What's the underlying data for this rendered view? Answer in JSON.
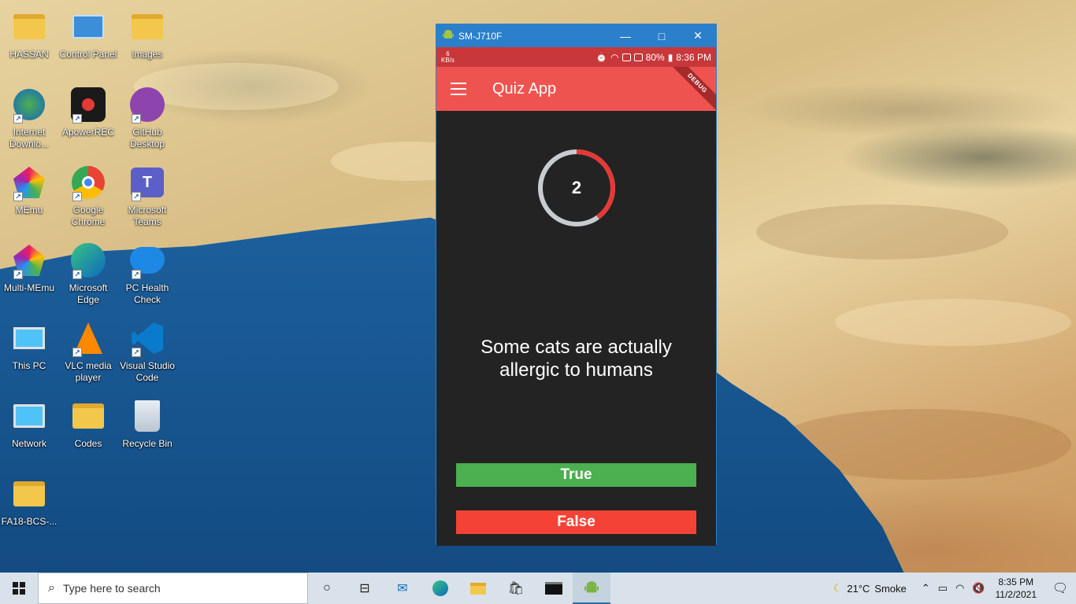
{
  "desktop": {
    "icons": [
      {
        "label": "HASSAN",
        "icon": "user-folder-icon"
      },
      {
        "label": "Control Panel",
        "icon": "control-panel-icon"
      },
      {
        "label": "images",
        "icon": "folder-icon"
      },
      {
        "label": "Internet Downlo...",
        "icon": "internet-download-manager-icon"
      },
      {
        "label": "ApowerREC",
        "icon": "apowerrec-icon"
      },
      {
        "label": "GitHub Desktop",
        "icon": "github-icon"
      },
      {
        "label": "MEmu",
        "icon": "memu-icon"
      },
      {
        "label": "Google Chrome",
        "icon": "chrome-icon"
      },
      {
        "label": "Microsoft Teams",
        "icon": "teams-icon"
      },
      {
        "label": "Multi-MEmu",
        "icon": "multi-memu-icon"
      },
      {
        "label": "Microsoft Edge",
        "icon": "edge-icon"
      },
      {
        "label": "PC Health Check",
        "icon": "health-check-icon"
      },
      {
        "label": "This PC",
        "icon": "computer-icon"
      },
      {
        "label": "VLC media player",
        "icon": "vlc-icon"
      },
      {
        "label": "Visual Studio Code",
        "icon": "vscode-icon"
      },
      {
        "label": "Network",
        "icon": "network-icon"
      },
      {
        "label": "Codes",
        "icon": "folder-icon"
      },
      {
        "label": "Recycle Bin",
        "icon": "recycle-bin-icon"
      },
      {
        "label": "FA18-BCS-...",
        "icon": "folder-icon"
      }
    ]
  },
  "emulator": {
    "window_title": "SM-J710F",
    "status_bar": {
      "speed_value": "6",
      "speed_unit": "KB/s",
      "battery": "80%",
      "time": "8:36 PM"
    },
    "app": {
      "title": "Quiz App",
      "debug_label": "DEBUG",
      "timer_value": "2",
      "timer_progress": 0.4,
      "question": "Some cats are actually allergic to humans",
      "true_label": "True",
      "false_label": "False"
    }
  },
  "taskbar": {
    "search_placeholder": "Type here to search",
    "weather_temp": "21°C",
    "weather_desc": "Smoke",
    "clock_time": "8:35 PM",
    "clock_date": "11/2/2021"
  },
  "colors": {
    "app_bar": "#ef5350",
    "status_bar": "#c8373a",
    "true_button": "#4caf50",
    "false_button": "#f44336",
    "title_bar": "#2b7fcb"
  }
}
